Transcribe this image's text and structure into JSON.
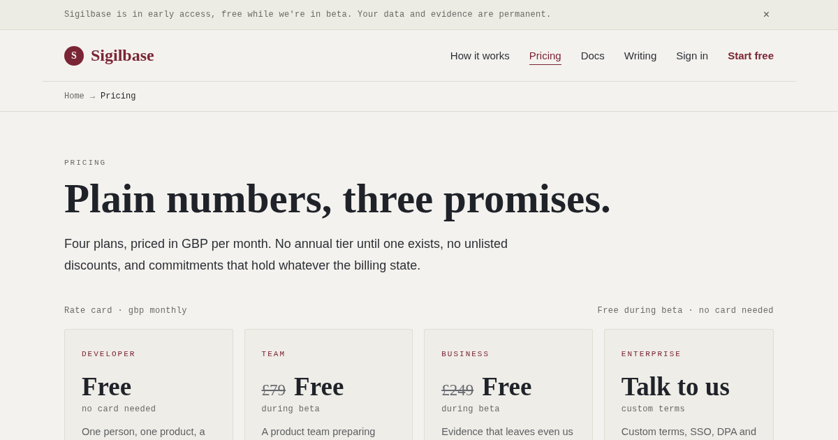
{
  "banner": {
    "message": "Sigilbase is in early access, free while we're in beta. Your data and evidence are permanent.",
    "close": "×"
  },
  "header": {
    "logo": {
      "mark": "S",
      "name": "Sigilbase"
    },
    "nav": [
      {
        "label": "How it works",
        "kind": "link",
        "selected": false
      },
      {
        "label": "Pricing",
        "kind": "link",
        "selected": true
      },
      {
        "label": "Docs",
        "kind": "link",
        "selected": false
      },
      {
        "label": "Writing",
        "kind": "link",
        "selected": false
      },
      {
        "label": "Sign in",
        "kind": "link",
        "selected": false
      },
      {
        "label": "Start free",
        "kind": "cta",
        "selected": false
      }
    ]
  },
  "breadcrumb": {
    "separator": "→",
    "items": [
      {
        "label": "Home",
        "current": false
      },
      {
        "label": "Pricing",
        "current": true
      }
    ]
  },
  "hero": {
    "eyebrow": "PRICING",
    "title": "Plain numbers, three promises.",
    "lead": "Four plans, priced in GBP per month. No annual tier until one exists, no unlisted discounts, and commitments that hold whatever the billing state."
  },
  "rate_card": {
    "caption": "Rate card · gbp monthly",
    "note": "Free during beta · no card needed",
    "plans": [
      {
        "name": "DEVELOPER",
        "price": "Free",
        "price_note": "no card needed",
        "description": "One person, one product, a"
      },
      {
        "name": "TEAM",
        "was": "£79",
        "price": "Free",
        "price_note": "during beta",
        "description": "A product team preparing"
      },
      {
        "name": "BUSINESS",
        "was": "£249",
        "price": "Free",
        "price_note": "during beta",
        "description": "Evidence that leaves even us"
      },
      {
        "name": "ENTERPRISE",
        "price": "Talk to us",
        "price_note": "custom terms",
        "description": "Custom terms, SSO, DPA and"
      }
    ]
  }
}
